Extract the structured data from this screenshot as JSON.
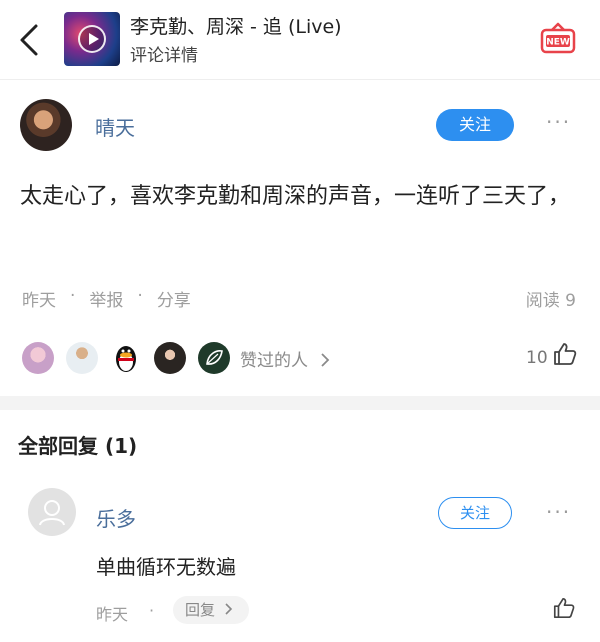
{
  "header": {
    "song_title": "李克勤、周深 - 追 (Live)",
    "subtitle": "评论详情",
    "new_badge": "NEW",
    "accent_color": "#2d8ff0"
  },
  "comment": {
    "username": "晴天",
    "follow_label": "关注",
    "more": "···",
    "text": "太走心了，喜欢李克勤和周深的声音，一连听了三天了，",
    "time": "昨天",
    "separator": "·",
    "report": "举报",
    "share": "分享",
    "read_count": "阅读 9",
    "liked_label": "赞过的人",
    "like_count": "10"
  },
  "replies": {
    "heading": "全部回复 (1)",
    "items": [
      {
        "username": "乐多",
        "follow_label": "关注",
        "more": "···",
        "text": "单曲循环无数遍",
        "time": "昨天",
        "separator": "·",
        "reply_label": "回复"
      }
    ]
  },
  "colors": {
    "username": "#4a6e9b",
    "follow_button": "#2d8ff0",
    "new_badge": "#e8434a",
    "meta_text": "#9e9e9e"
  }
}
